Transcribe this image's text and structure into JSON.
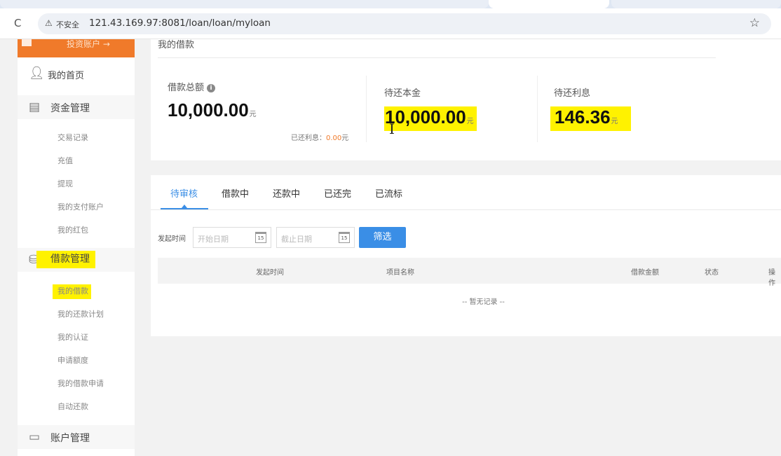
{
  "browser": {
    "security_label": "不安全",
    "url": "121.43.169.97:8081/loan/loan/myloan"
  },
  "sidebar": {
    "invest_button": "投资账户 →",
    "groups": [
      {
        "label": "我的首页",
        "icon": "user-icon"
      },
      {
        "label": "资金管理",
        "icon": "money-icon",
        "items": [
          "交易记录",
          "充值",
          "提现",
          "我的支付账户",
          "我的红包"
        ]
      },
      {
        "label": "借款管理",
        "icon": "loan-icon",
        "items": [
          "我的借款",
          "我的还款计划",
          "我的认证",
          "申请额度",
          "我的借款申请",
          "自动还款"
        ]
      },
      {
        "label": "账户管理",
        "icon": "card-icon"
      }
    ]
  },
  "summary": {
    "title": "我的借款",
    "total_label": "借款总额",
    "total_value": "10,000.00",
    "principal_label": "待还本金",
    "principal_value": "10,000.00",
    "interest_label": "待还利息",
    "interest_value": "146.36",
    "unit": "元",
    "paid_interest_label": "已还利息：",
    "paid_interest_value": "0.00",
    "highlight_color": "#fff200"
  },
  "list": {
    "tabs": [
      "待审核",
      "借款中",
      "还款中",
      "已还完",
      "已流标"
    ],
    "active_tab": 0,
    "filter_label": "发起时间",
    "start_placeholder": "开始日期",
    "end_placeholder": "截止日期",
    "calendar_day": "15",
    "filter_button": "筛选",
    "columns": [
      "发起时间",
      "项目名称",
      "借款金额",
      "状态",
      "操作"
    ],
    "empty_text": "-- 暂无记录 --"
  },
  "colors": {
    "accent": "#3a8ee6",
    "orange": "#f07a2a"
  }
}
